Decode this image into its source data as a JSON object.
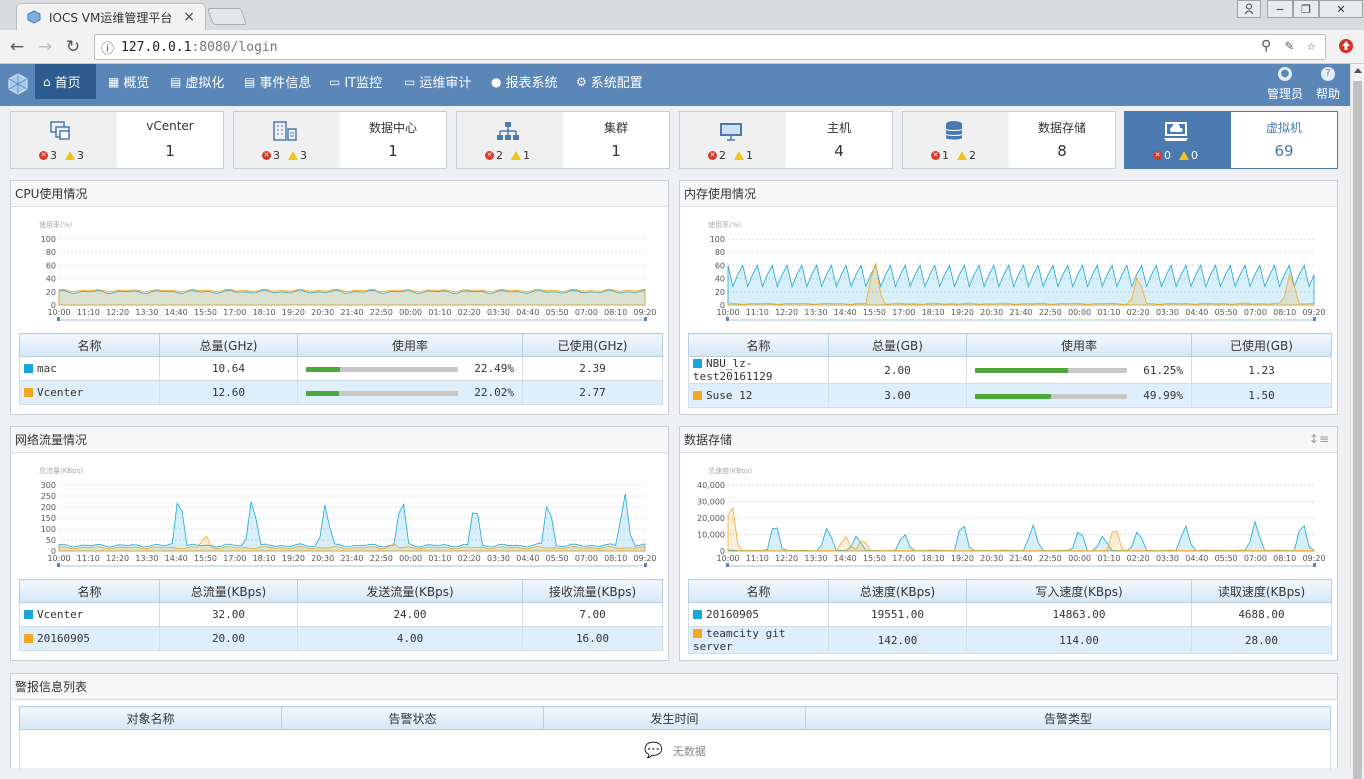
{
  "browser": {
    "tab_title": "IOCS VM运维管理平台",
    "tab_close": "×",
    "url_host": "127.0.0.1",
    "url_path": ":8080/login"
  },
  "nav": {
    "items": [
      {
        "label": "首页",
        "icon": "⌂"
      },
      {
        "label": "概览",
        "icon": "▦"
      },
      {
        "label": "虚拟化",
        "icon": "▤"
      },
      {
        "label": "事件信息",
        "icon": "▤"
      },
      {
        "label": "IT监控",
        "icon": "▭"
      },
      {
        "label": "运维审计",
        "icon": "▭"
      },
      {
        "label": "报表系统",
        "icon": "●"
      },
      {
        "label": "系统配置",
        "icon": "⚙"
      }
    ],
    "admin": "管理员",
    "help": "帮助"
  },
  "cards": [
    {
      "label": "vCenter",
      "count": "1",
      "errors": "3",
      "warnings": "3"
    },
    {
      "label": "数据中心",
      "count": "1",
      "errors": "3",
      "warnings": "3"
    },
    {
      "label": "集群",
      "count": "1",
      "errors": "2",
      "warnings": "1"
    },
    {
      "label": "主机",
      "count": "4",
      "errors": "2",
      "warnings": "1"
    },
    {
      "label": "数据存储",
      "count": "8",
      "errors": "1",
      "warnings": "2"
    },
    {
      "label": "虚拟机",
      "count": "69",
      "errors": "0",
      "warnings": "0"
    }
  ],
  "panels": {
    "cpu": {
      "title": "CPU使用情况",
      "cols": [
        "名称",
        "总量(GHz)",
        "使用率",
        "已使用(GHz)"
      ],
      "rows": [
        {
          "name": "mac",
          "total": "10.64",
          "pct_text": "22.49%",
          "pct": 0.2249,
          "used": "2.39",
          "color": "#1aa6d8"
        },
        {
          "name": "Vcenter",
          "total": "12.60",
          "pct_text": "22.02%",
          "pct": 0.2202,
          "used": "2.77",
          "color": "#f5a623"
        }
      ]
    },
    "mem": {
      "title": "内存使用情况",
      "cols": [
        "名称",
        "总量(GB)",
        "使用率",
        "已使用(GB)"
      ],
      "rows": [
        {
          "name": "NBU_lz-test20161129",
          "total": "2.00",
          "pct_text": "61.25%",
          "pct": 0.6125,
          "used": "1.23",
          "color": "#1aa6d8"
        },
        {
          "name": "Suse 12",
          "total": "3.00",
          "pct_text": "49.99%",
          "pct": 0.4999,
          "used": "1.50",
          "color": "#f5a623"
        }
      ]
    },
    "net": {
      "title": "网络流量情况",
      "cols": [
        "名称",
        "总流量(KBps)",
        "发送流量(KBps)",
        "接收流量(KBps)"
      ],
      "rows": [
        {
          "name": "Vcenter",
          "total": "32.00",
          "sent": "24.00",
          "recv": "7.00",
          "color": "#1aa6d8"
        },
        {
          "name": "20160905",
          "total": "20.00",
          "sent": "4.00",
          "recv": "16.00",
          "color": "#f5a623"
        }
      ]
    },
    "store": {
      "title": "数据存储",
      "cols": [
        "名称",
        "总速度(KBps)",
        "写入速度(KBps)",
        "读取速度(KBps)"
      ],
      "rows": [
        {
          "name": "20160905",
          "total": "19551.00",
          "write": "14863.00",
          "read": "4688.00",
          "color": "#1aa6d8"
        },
        {
          "name": "teamcity git server",
          "total": "142.00",
          "write": "114.00",
          "read": "28.00",
          "color": "#f5a623"
        }
      ]
    },
    "alerts": {
      "title": "警报信息列表",
      "cols": [
        "对象名称",
        "告警状态",
        "发生时间",
        "告警类型"
      ],
      "empty": "无数据"
    }
  },
  "chart_data": [
    {
      "type": "area",
      "id": "cpu",
      "ylabel": "使用率(%)",
      "yticks": [
        "100",
        "80",
        "60",
        "40",
        "20",
        "0"
      ],
      "ylim": [
        0,
        100
      ],
      "x": [
        "10:00",
        "11:10",
        "12:20",
        "13:30",
        "14:40",
        "15:50",
        "17:00",
        "18:10",
        "19:20",
        "20:30",
        "21:40",
        "22:50",
        "00:00",
        "01:10",
        "02:20",
        "03:30",
        "04:40",
        "05:50",
        "07:00",
        "08:10",
        "09:20"
      ],
      "series": [
        {
          "name": "mac",
          "color": "#1aa6d8",
          "pattern": "flat",
          "base": 20,
          "amp": 3,
          "peaks": [
            [
              0.56,
              10
            ]
          ]
        },
        {
          "name": "Vcenter",
          "color": "#f5a623",
          "pattern": "flat",
          "base": 22,
          "amp": 2,
          "peaks": []
        }
      ]
    },
    {
      "type": "area",
      "id": "mem",
      "ylabel": "使用率(%)",
      "yticks": [
        "100",
        "80",
        "60",
        "40",
        "20",
        "0"
      ],
      "ylim": [
        0,
        100
      ],
      "x": [
        "10:00",
        "11:10",
        "12:20",
        "13:30",
        "14:40",
        "15:50",
        "17:00",
        "18:10",
        "19:20",
        "20:30",
        "21:40",
        "22:50",
        "00:00",
        "01:10",
        "02:20",
        "03:30",
        "04:40",
        "05:50",
        "07:00",
        "08:10",
        "09:20"
      ],
      "series": [
        {
          "name": "NBU_lz-test20161129",
          "color": "#1aa6d8",
          "pattern": "zigzag",
          "base": 40,
          "amp": 20,
          "peaks": []
        },
        {
          "name": "Suse 12",
          "color": "#f5a623",
          "pattern": "flat",
          "base": 2,
          "amp": 1,
          "peaks": [
            [
              0.25,
              75
            ],
            [
              0.7,
              50
            ],
            [
              0.96,
              55
            ]
          ]
        }
      ]
    },
    {
      "type": "area",
      "id": "net",
      "ylabel": "总流量(KBps)",
      "yticks": [
        "300",
        "250",
        "200",
        "150",
        "100",
        "50",
        "0"
      ],
      "ylim": [
        0,
        300
      ],
      "x": [
        "10:00",
        "11:10",
        "12:20",
        "13:30",
        "14:40",
        "15:50",
        "17:00",
        "18:10",
        "19:20",
        "20:30",
        "21:40",
        "22:50",
        "00:00",
        "01:10",
        "02:20",
        "03:30",
        "04:40",
        "05:50",
        "07:00",
        "08:10",
        "09:20"
      ],
      "series": [
        {
          "name": "Vcenter",
          "color": "#1aa6d8",
          "pattern": "flat",
          "base": 25,
          "amp": 8,
          "peaks": [
            [
              0.205,
              290
            ],
            [
              0.33,
              270
            ],
            [
              0.455,
              230
            ],
            [
              0.585,
              280
            ],
            [
              0.71,
              250
            ],
            [
              0.835,
              260
            ],
            [
              0.965,
              290
            ]
          ]
        },
        {
          "name": "20160905",
          "color": "#f5a623",
          "pattern": "flat",
          "base": 15,
          "amp": 6,
          "peaks": [
            [
              0.25,
              80
            ],
            [
              0.57,
              40
            ]
          ]
        }
      ]
    },
    {
      "type": "area",
      "id": "store",
      "ylabel": "总速度(KBps)",
      "yticks": [
        "40,000",
        "30,000",
        "20,000",
        "10,000",
        "0"
      ],
      "ylim": [
        0,
        40000
      ],
      "x": [
        "10:00",
        "11:10",
        "12:20",
        "13:30",
        "14:40",
        "15:50",
        "17:00",
        "18:10",
        "19:20",
        "20:30",
        "21:40",
        "22:50",
        "00:00",
        "01:10",
        "02:20",
        "03:30",
        "04:40",
        "05:50",
        "07:00",
        "08:10",
        "09:20"
      ],
      "series": [
        {
          "name": "20160905",
          "color": "#1aa6d8",
          "pattern": "flat",
          "base": 300,
          "amp": 200,
          "peaks": [
            [
              0.08,
              20000
            ],
            [
              0.17,
              16000
            ],
            [
              0.22,
              10000
            ],
            [
              0.3,
              12000
            ],
            [
              0.4,
              20000
            ],
            [
              0.52,
              17000
            ],
            [
              0.6,
              15000
            ],
            [
              0.64,
              10000
            ],
            [
              0.7,
              14000
            ],
            [
              0.78,
              17000
            ],
            [
              0.9,
              19000
            ],
            [
              0.98,
              20000
            ]
          ]
        },
        {
          "name": "teamcity git server",
          "color": "#f5a623",
          "pattern": "flat",
          "base": 200,
          "amp": 100,
          "peaks": [
            [
              0.005,
              35000
            ],
            [
              0.2,
              10000
            ],
            [
              0.23,
              8000
            ],
            [
              0.66,
              17000
            ]
          ]
        }
      ]
    }
  ]
}
